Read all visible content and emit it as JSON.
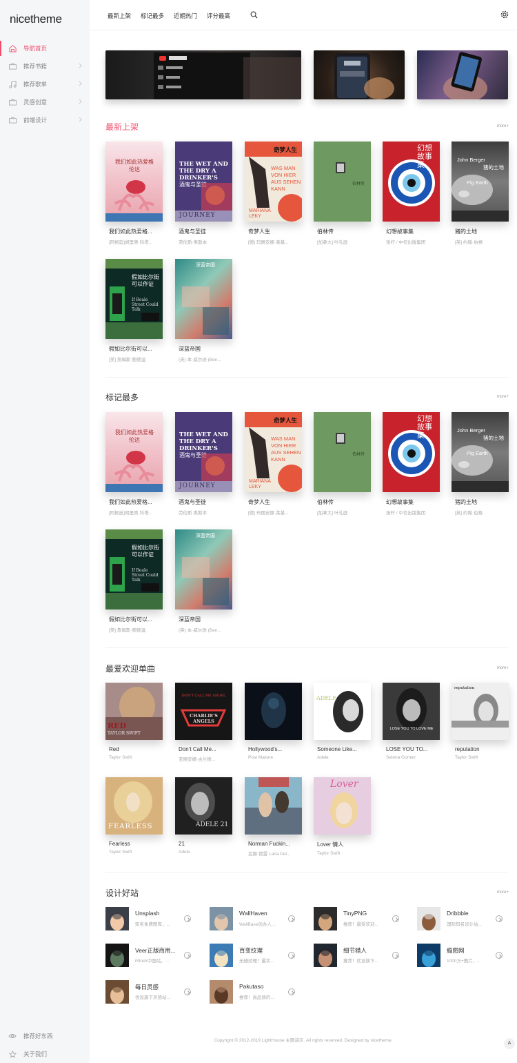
{
  "app": {
    "logo": "nicetheme"
  },
  "sidebar": {
    "items": [
      {
        "label": "导航首页",
        "icon": "home-icon",
        "active": true
      },
      {
        "label": "推荐书籍",
        "icon": "briefcase-icon"
      },
      {
        "label": "推荐歌单",
        "icon": "music-icon"
      },
      {
        "label": "灵感创意",
        "icon": "briefcase-icon"
      },
      {
        "label": "前端设计",
        "icon": "briefcase-icon"
      }
    ],
    "bottom": [
      {
        "label": "推荐好东西",
        "icon": "eye-icon"
      },
      {
        "label": "关于我们",
        "icon": "star-icon"
      }
    ]
  },
  "header": {
    "nav": [
      "最新上架",
      "标记最多",
      "近期热门",
      "评分最高"
    ],
    "search_icon": "search-icon",
    "settings_icon": "gear-icon"
  },
  "sections": {
    "newest": {
      "title": "最新上架",
      "more": "more+"
    },
    "marked": {
      "title": "标记最多",
      "more": "more+"
    },
    "songs": {
      "title": "最爱欢迎单曲",
      "more": "more+"
    },
    "sites": {
      "title": "设计好站",
      "more": "more+"
    }
  },
  "books": [
    {
      "title": "我们如此热爱格...",
      "author": "[阿根廷]胡里奥·科塔..."
    },
    {
      "title": "酒鬼与圣徒",
      "author": "劳伦斯·奥斯本"
    },
    {
      "title": "奇梦人生",
      "author": "[德] 玛丽安娜·莱基..."
    },
    {
      "title": "伯林传",
      "author": "[加拿大] 叶礼庭"
    },
    {
      "title": "幻想故事集",
      "author": "张柠 / 中信出版集团"
    },
    {
      "title": "猪的土地",
      "author": "[英] 约翰·伯格"
    },
    {
      "title": "假如比尔街可以...",
      "author": "[美] 詹姆斯·鲍德温"
    },
    {
      "title": "深蓝帝国",
      "author": "(英) 本·威尔逊 (Ben..."
    }
  ],
  "covers": {
    "c1": "我们如此热爱格伦达",
    "c2": "THE WET AND THE DRY A DRINKER'S",
    "c2b": "JOURNEY",
    "c2c": "酒鬼与圣徒",
    "c3": "奇梦人生",
    "c3b": "WAS MAN VON HIER AUS SEHEN KANN",
    "c3c": "MARIANA LEKY",
    "c4": "伯林传",
    "c5": "幻想故事集",
    "c6": "John Berger",
    "c6b": "猪的土地",
    "c6c": "Pig Earth",
    "c7": "假如比尔街可以作证",
    "c7b": "If Beale Street Could Talk",
    "c8": "深蓝帝国"
  },
  "songs": [
    {
      "title": "Red",
      "artist": "Taylor Swift"
    },
    {
      "title": "Don’t Call Me...",
      "artist": "亚丽安娜·古兰德..."
    },
    {
      "title": "Hollywood’s...",
      "artist": "Post Malone"
    },
    {
      "title": "Someone Like...",
      "artist": "Adele"
    },
    {
      "title": "LOSE YOU TO...",
      "artist": "Selena Gomez"
    },
    {
      "title": "reputation",
      "artist": "Taylor Swift"
    },
    {
      "title": "Fearless",
      "artist": "Taylor Swift"
    },
    {
      "title": "21",
      "artist": "Adele"
    },
    {
      "title": "Norman Fuckin...",
      "artist": "拉娜·德雷 Lana Del..."
    },
    {
      "title": "Lover 情人",
      "artist": "Taylor Swift"
    }
  ],
  "album_text": {
    "red": "RED",
    "red2": "TAYLOR SWIFT",
    "cca": "CHARLIE'S ANGELS",
    "cca2": "DON'T CALL ME ANGEL",
    "adele": "ADELE",
    "lose": "LOSE YOU TO LOVE ME",
    "rep": "reputation",
    "fear": "FEARLESS",
    "a21": "ADELE 21",
    "lover": "Lover"
  },
  "sites": [
    {
      "name": "Unsplash",
      "desc": "知名免费图库，..."
    },
    {
      "name": "WallHaven",
      "desc": "WallBase创办人..."
    },
    {
      "name": "TinyPNG",
      "desc": "推荐！最受欢迎..."
    },
    {
      "name": "Dribbble",
      "desc": "国际知名设计站..."
    },
    {
      "name": "Veer正版商用...",
      "desc": "iStock中国站，..."
    },
    {
      "name": "百变纹理",
      "desc": "无缝纹理！最实..."
    },
    {
      "name": "细节猎人",
      "desc": "推荐！优设旗下..."
    },
    {
      "name": "瘾图网",
      "desc": "1000万+图片，..."
    },
    {
      "name": "每日灵感",
      "desc": "优设旗下灵感站..."
    },
    {
      "name": "Pakutaso",
      "desc": "推荐！高品质的..."
    }
  ],
  "footer": "Copyright © 2012-2019 LightHouse 主题演示. All rights reserved. Designed by nicetheme.",
  "fab": "A",
  "colors": {
    "accent": "#f0506e",
    "sidebar_bg": "#f5f6f8"
  }
}
